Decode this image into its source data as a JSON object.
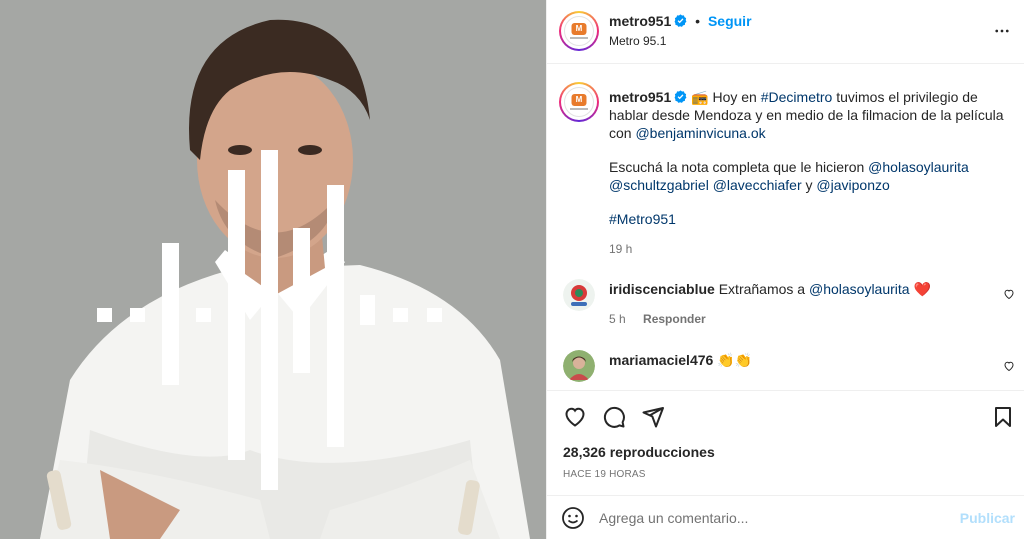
{
  "post": {
    "username": "metro951",
    "follow_label": "Seguir",
    "separator": "•",
    "subtitle": "Metro 95.1"
  },
  "caption": {
    "username": "metro951",
    "text_1": "📻 Hoy en ",
    "hashtag_1": "#Decimetro",
    "text_2": " tuvimos el privilegio de hablar desde Mendoza y en medio de la filmacion de la película con ",
    "mention_1": "@benjaminvicuna.ok",
    "text_3": "Escuchá la nota completa que le hicieron ",
    "mention_2": "@holasoylaurita",
    "mention_3": "@schultzgabriel",
    "mention_4": "@lavecchiafer",
    "text_4": " y ",
    "mention_5": "@javiponzo",
    "hashtag_2": "#Metro951",
    "time": "19 h"
  },
  "comments": [
    {
      "username": "iridiscenciablue",
      "text": "Extrañamos a ",
      "mention": "@holasoylaurita",
      "emoji": "❤️",
      "time": "5 h",
      "reply_label": "Responder"
    },
    {
      "username": "mariamaciel476",
      "text": "👏👏"
    }
  ],
  "stats": {
    "views": "28,326 reproducciones",
    "posted": "HACE 19 HORAS"
  },
  "add_comment": {
    "placeholder": "Agrega un comentario...",
    "publish_label": "Publicar"
  },
  "icons": {
    "like": "heart-icon",
    "comment": "comment-icon",
    "share": "share-icon",
    "save": "bookmark-icon",
    "emoji": "emoji-icon",
    "more": "more-options-icon",
    "verified": "verified-badge-icon"
  },
  "colors": {
    "link": "#00376b",
    "follow": "#0095f6",
    "verified": "#0095f6",
    "heart_red": "#ed4956",
    "publish_disabled": "#b2dffc"
  }
}
